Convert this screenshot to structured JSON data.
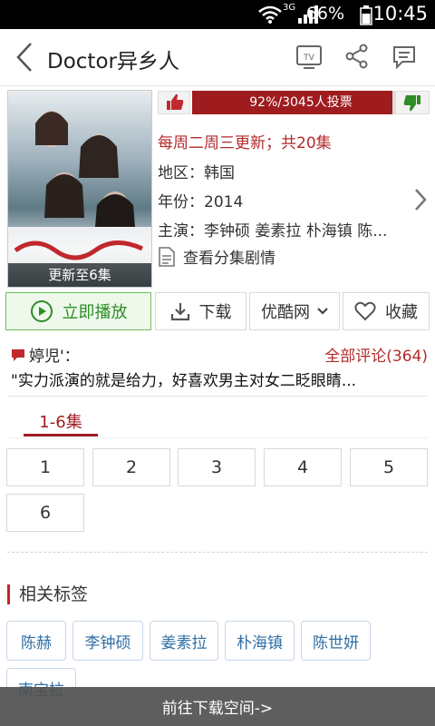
{
  "status_bar": {
    "network": "3G",
    "battery_percent": "66%",
    "time": "10:45"
  },
  "header": {
    "title": "Doctor异乡人",
    "icons": [
      "back-icon",
      "tv-icon",
      "share-icon",
      "comment-icon"
    ]
  },
  "poster": {
    "caption": "更新至6集"
  },
  "vote": {
    "text": "92%/3045人投票",
    "percent": 92
  },
  "info": {
    "schedule": "每周二周三更新；共20集",
    "region": "地区：韩国",
    "year": "年份：2014",
    "cast": "主演：李钟硕 姜素拉 朴海镇 陈...",
    "episode_guide": "查看分集剧情"
  },
  "actions": {
    "play": "立即播放",
    "download": "下载",
    "source": "优酷网",
    "favorite": "收藏"
  },
  "comment": {
    "user": "婷児'：",
    "all_label": "全部评论(364)",
    "text": "\"实力派演的就是给力，好喜欢男主对女二眨眼睛..."
  },
  "episodes": {
    "tab_label": "1-6集",
    "items": [
      "1",
      "2",
      "3",
      "4",
      "5",
      "6"
    ]
  },
  "tags": {
    "section_title": "相关标签",
    "items": [
      "陈赫",
      "李钟硕",
      "姜素拉",
      "朴海镇",
      "陈世妍",
      "南宝拉"
    ]
  },
  "footer": {
    "label": "前往下载空间->"
  },
  "colors": {
    "accent_red": "#9e1b1e",
    "play_green": "#2f8c27",
    "tag_blue": "#2f6ea5"
  }
}
